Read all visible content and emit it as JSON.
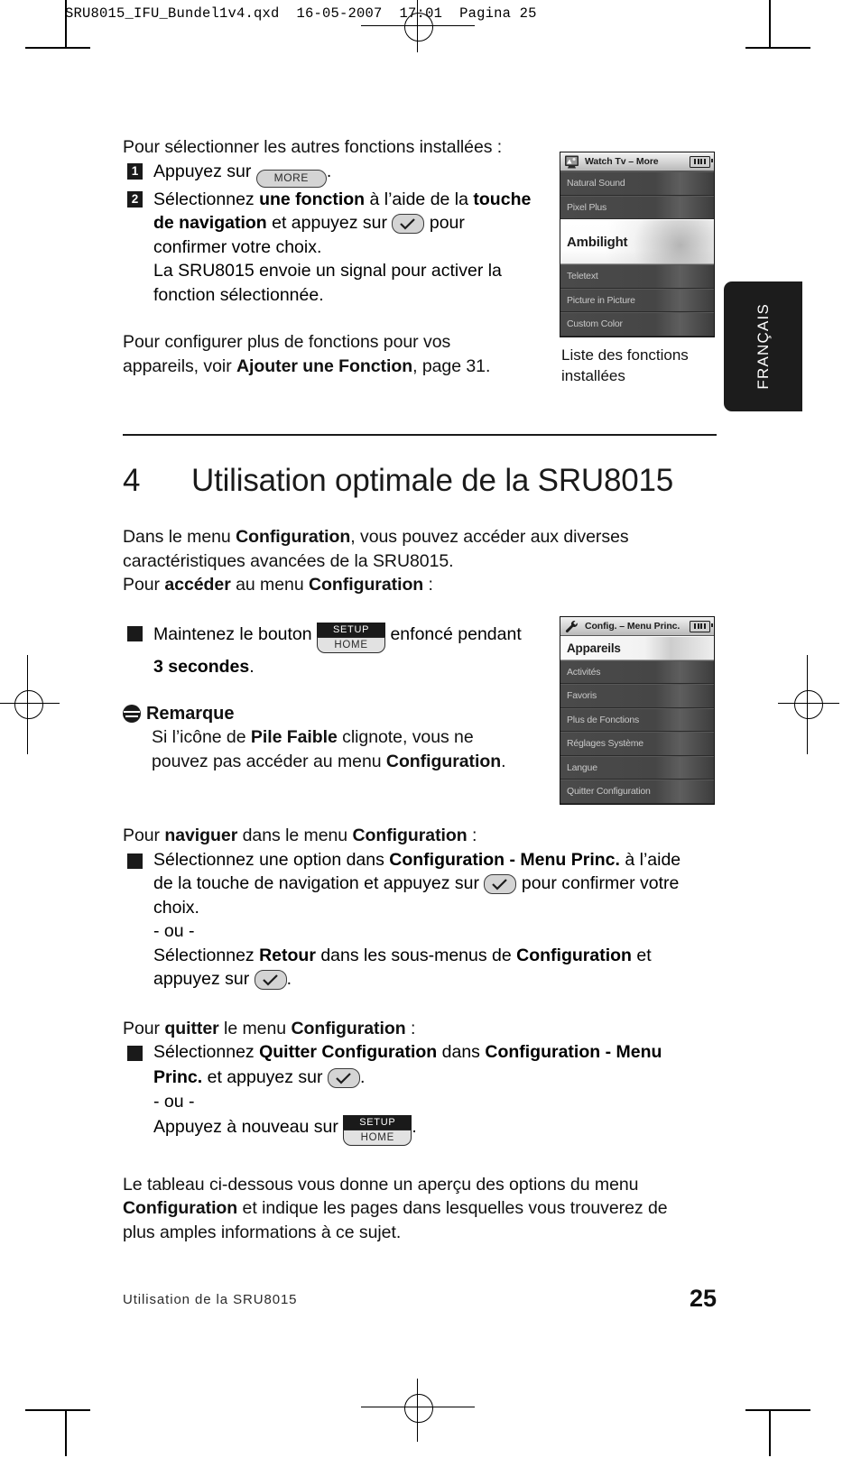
{
  "print_header": "SRU8015_IFU_Bundel1v4.qxd  16-05-2007  17:01  Pagina 25",
  "intro": {
    "lead": "Pour sélectionner les autres fonctions installées :",
    "step1": {
      "num": "1",
      "pre": "Appuyez sur ",
      "key": "MORE",
      "post": "."
    },
    "step2": {
      "num": "2",
      "line1_a": "Sélectionnez ",
      "line1_b": "une fonction",
      "line1_c": " à l’aide de la ",
      "line1_d": "touche",
      "line2_a": "de navigation",
      "line2_b": " et appuyez sur ",
      "line2_c": " pour",
      "line3": "confirmer votre choix.",
      "line4": "La SRU8015 envoie un signal pour activer la",
      "line5": "fonction sélectionnée."
    },
    "outro_line1": "Pour configurer plus de fonctions pour vos",
    "outro_line2_a": "appareils, voir ",
    "outro_line2_b": "Ajouter une Fonction",
    "outro_line2_c": ", page 31."
  },
  "lcd_top": {
    "icon": "tv-icon",
    "title": "Watch Tv – More",
    "battery": "battery-full-icon",
    "items": [
      {
        "label": "Natural Sound",
        "selected": false
      },
      {
        "label": "Pixel Plus",
        "selected": false
      },
      {
        "label": "Ambilight",
        "selected": true
      },
      {
        "label": "Teletext",
        "selected": false
      },
      {
        "label": "Picture in Picture",
        "selected": false
      },
      {
        "label": "Custom Color",
        "selected": false
      }
    ],
    "caption_line1": "Liste des fonctions",
    "caption_line2": "installées"
  },
  "lcd_bottom": {
    "icon": "wrench-icon",
    "title": "Config. – Menu Princ.",
    "battery": "battery-full-icon",
    "items": [
      {
        "label": "Appareils",
        "selected": true
      },
      {
        "label": "Activités",
        "selected": false
      },
      {
        "label": "Favoris",
        "selected": false
      },
      {
        "label": "Plus de Fonctions",
        "selected": false
      },
      {
        "label": "Réglages Système",
        "selected": false
      },
      {
        "label": "Langue",
        "selected": false
      },
      {
        "label": "Quitter Configuration",
        "selected": false
      }
    ]
  },
  "language_tab": "FRANÇAIS",
  "chapter": {
    "number": "4",
    "title": "Utilisation optimale de la SRU8015"
  },
  "body": {
    "p1_a": "Dans le menu ",
    "p1_b": "Configuration",
    "p1_c": ", vous pouvez accéder aux diverses",
    "p1_d": "caractéristiques avancées de la SRU8015.",
    "p2_a": "Pour ",
    "p2_b": "accéder",
    "p2_c": " au menu ",
    "p2_d": "Configuration",
    "p2_e": " :",
    "hold_a": "Maintenez le bouton ",
    "hold_key_top": "SETUP",
    "hold_key_bottom": "HOME",
    "hold_b": " enfoncé pendant",
    "hold_c": "3 secondes",
    "hold_d": ".",
    "remarque_title": "Remarque",
    "remarque_a": "Si l’icône de ",
    "remarque_b": "Pile Faible",
    "remarque_c": " clignote, vous ne",
    "remarque_d": "pouvez pas accéder au menu ",
    "remarque_e": "Configuration",
    "remarque_f": ".",
    "nav_head_a": "Pour ",
    "nav_head_b": "naviguer",
    "nav_head_c": " dans le menu ",
    "nav_head_d": "Configuration",
    "nav_head_e": " :",
    "nav_1a": "Sélectionnez une option dans ",
    "nav_1b": "Configuration - Menu Princ.",
    "nav_1c": " à l’aide",
    "nav_2a": "de la touche de navigation et appuyez sur ",
    "nav_2b": " pour confirmer votre",
    "nav_3": "choix.",
    "ou": "- ou -",
    "nav_4a": "Sélectionnez ",
    "nav_4b": "Retour",
    "nav_4c": " dans les sous-menus de ",
    "nav_4d": "Configuration",
    "nav_4e": " et",
    "nav_5a": "appuyez sur ",
    "nav_5b": ".",
    "quit_head_a": "Pour ",
    "quit_head_b": "quitter",
    "quit_head_c": " le menu ",
    "quit_head_d": "Configuration",
    "quit_head_e": " :",
    "quit_1a": "Sélectionnez ",
    "quit_1b": "Quitter Configuration",
    "quit_1c": " dans ",
    "quit_1d": "Configuration - Menu",
    "quit_2a": "Princ.",
    "quit_2b": " et appuyez sur ",
    "quit_2c": ".",
    "quit_ou": "- ou -",
    "quit_3a": "Appuyez à nouveau sur ",
    "quit_3_key": "HOME",
    "quit_3b": ".",
    "final_1": "Le tableau ci-dessous vous donne un aperçu des options du menu",
    "final_2a": "Configuration",
    "final_2b": " et indique les pages dans lesquelles vous trouverez de",
    "final_3": "plus amples informations à ce sujet."
  },
  "footer": {
    "left": "Utilisation de la SRU8015",
    "page_number": "25"
  }
}
